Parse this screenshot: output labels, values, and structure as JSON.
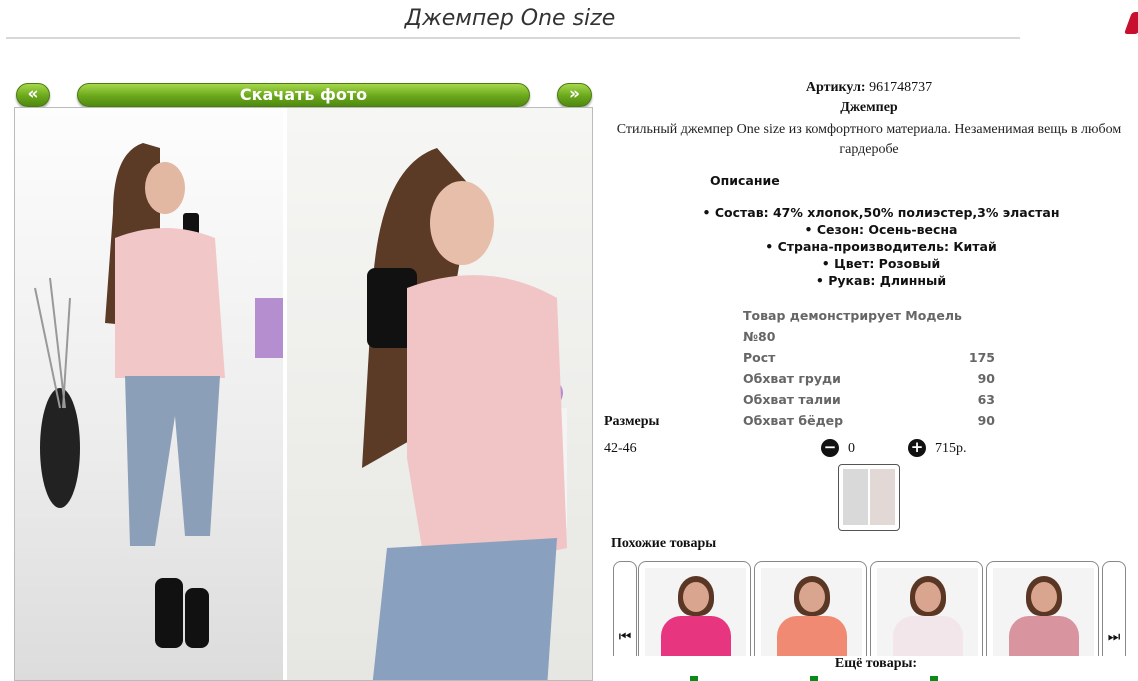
{
  "page": {
    "title": "Джемпер One size"
  },
  "gallery": {
    "prev_label": "«",
    "next_label": "»",
    "download_label": "Скачать фото"
  },
  "product": {
    "article_label": "Артикул:",
    "article_value": "961748737",
    "name": "Джемпер",
    "short_description": "Стильный джемпер One size из комфортного материала. Незаменимая вещь в любом гардеробе"
  },
  "description": {
    "heading": "Описание",
    "bullets": [
      "• Состав: 47% хлопок,50% полиэстер,3% эластан",
      "• Сезон: Осень-весна",
      "• Страна-производитель: Китай",
      "• Цвет: Розовый",
      "• Рукав: Длинный"
    ]
  },
  "model": {
    "heading": "Товар демонстрирует Модель №80",
    "rows": [
      {
        "label": "Рост",
        "value": "175"
      },
      {
        "label": "Обхват груди",
        "value": "90"
      },
      {
        "label": "Обхват талии",
        "value": "63"
      },
      {
        "label": "Обхват бёдер",
        "value": "90"
      }
    ]
  },
  "sizes": {
    "heading": "Размеры",
    "size": "42-46",
    "quantity": "0",
    "price": "715р.",
    "minus_icon": "minus-circle-icon",
    "plus_icon": "plus-circle-icon"
  },
  "similar": {
    "heading": "Похожие товары",
    "prev_icon": "skip-back-icon",
    "next_icon": "skip-forward-icon",
    "cards": [
      {
        "color": "#e8357f"
      },
      {
        "color": "#f08a72"
      },
      {
        "color": "#f3e6ea"
      },
      {
        "color": "#d8949f"
      }
    ]
  },
  "more": {
    "heading": "Ещё товары:"
  },
  "colors": {
    "button_green": "#6aa71c",
    "link_green": "#0a8a1a"
  }
}
